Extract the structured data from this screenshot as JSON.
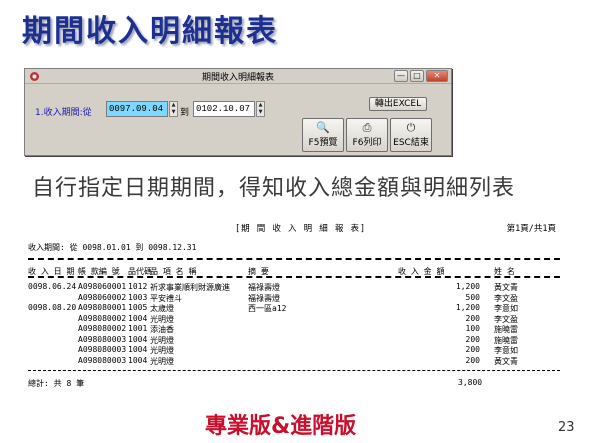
{
  "slide": {
    "title": "期間收入明細報表",
    "subtitle": "自行指定日期期間，得知收入總金額與明細列表",
    "footer": "專業版&進階版",
    "page_number": "23"
  },
  "dialog": {
    "title": "期間收入明細報表",
    "range_label": "1.收入期間:從",
    "from_date": "0097.09.04",
    "to_label": "到",
    "to_date": "0102.10.07",
    "excel_button": "轉出EXCEL",
    "buttons": [
      {
        "label": "F5預覽",
        "icon": "preview-icon"
      },
      {
        "label": "F6列印",
        "icon": "printer-icon"
      },
      {
        "label": "ESC結束",
        "icon": "exit-icon"
      }
    ]
  },
  "report": {
    "title": "[期 間 收 入 明 細 報 表]",
    "page": "第1頁/共1頁",
    "range": "收入期間: 從 0098.01.01 到 0098.12.31",
    "headers": {
      "date": "收 入 日 期",
      "voucher": "帳 款編 號",
      "code": "品代碼",
      "item": "品 項 名 稱",
      "note": "摘 要",
      "amount": "收 入 金 額",
      "name": "姓 名"
    },
    "rows": [
      {
        "date": "0098.06.24",
        "voucher": "A098060001",
        "code": "1012",
        "item": "祈求事業順利財源廣進",
        "note": "福祿壽燈",
        "amount": "1,200",
        "name": "黃文青"
      },
      {
        "date": "",
        "voucher": "A098060002",
        "code": "1003",
        "item": "平安禮斗",
        "note": "福祿壽燈",
        "amount": "500",
        "name": "李文盈"
      },
      {
        "date": "0098.08.20",
        "voucher": "A098080001",
        "code": "1005",
        "item": "太歲燈",
        "note": "西一區a12",
        "amount": "1,200",
        "name": "李意如"
      },
      {
        "date": "",
        "voucher": "A098080002",
        "code": "1004",
        "item": "光明燈",
        "note": "",
        "amount": "200",
        "name": "李文盈"
      },
      {
        "date": "",
        "voucher": "A098080002",
        "code": "1001",
        "item": "添油香",
        "note": "",
        "amount": "100",
        "name": "施曉雷"
      },
      {
        "date": "",
        "voucher": "A098080003",
        "code": "1004",
        "item": "光明燈",
        "note": "",
        "amount": "200",
        "name": "施曉雷"
      },
      {
        "date": "",
        "voucher": "A098080003",
        "code": "1004",
        "item": "光明燈",
        "note": "",
        "amount": "200",
        "name": "李意如"
      },
      {
        "date": "",
        "voucher": "A098080003",
        "code": "1004",
        "item": "光明燈",
        "note": "",
        "amount": "200",
        "name": "黃文青"
      }
    ],
    "total_label": "總計: 共 8 筆",
    "total_amount": "3,800"
  }
}
